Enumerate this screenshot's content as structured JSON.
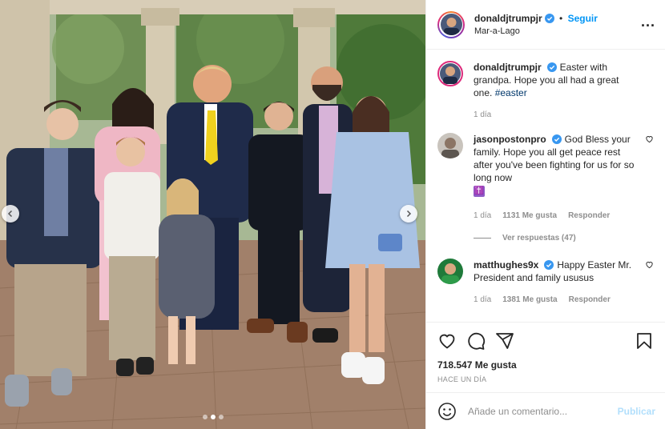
{
  "post": {
    "author": {
      "username": "donaldjtrumpjr",
      "verified": true,
      "location": "Mar-a-Lago",
      "follow_separator": "•",
      "follow_label": "Seguir"
    },
    "more_label": "...",
    "carousel": {
      "total_slides": 3,
      "active_slide": 2
    },
    "caption": {
      "username": "donaldjtrumpjr",
      "text": "Easter with grandpa. Hope you all had a great one.",
      "hashtag": "#easter",
      "age": "1 día"
    },
    "comments": [
      {
        "username": "jasonpostonpro",
        "verified": true,
        "text": "God Bless your family. Hope you all get peace rest after you've been fighting for us for so long now",
        "emoji": "✝️",
        "age": "1 día",
        "likes": "1131 Me gusta",
        "reply_label": "Responder",
        "view_replies": "Ver respuestas (47)"
      },
      {
        "username": "matthughes9x",
        "verified": true,
        "text": "Happy Easter Mr. President and family ususus",
        "age": "1 día",
        "likes": "1381 Me gusta",
        "reply_label": "Responder"
      }
    ],
    "likes_count": "718.547 Me gusta",
    "timestamp": "HACE UN DÍA",
    "comment_input": {
      "placeholder": "Añade un comentario...",
      "publish_label": "Publicar"
    },
    "icons": {
      "like": "heart-icon",
      "comment": "comment-bubble-icon",
      "share": "paper-plane-icon",
      "save": "bookmark-icon",
      "emoji": "smiley-icon",
      "prev": "chevron-left-icon",
      "next": "chevron-right-icon"
    },
    "colors": {
      "accent": "#0095f6",
      "verified": "#3897f0",
      "muted": "#8e8e8e",
      "publish_disabled": "#b2dffc"
    }
  }
}
